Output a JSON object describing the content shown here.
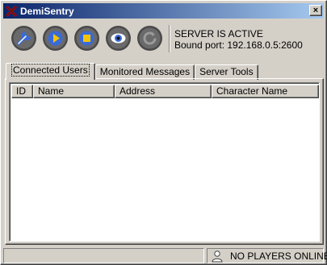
{
  "window": {
    "title": "DemiSentry",
    "close_glyph": "×"
  },
  "toolbar": {
    "buttons": [
      {
        "icon": "wrench-icon"
      },
      {
        "icon": "play-icon"
      },
      {
        "icon": "stop-icon"
      },
      {
        "icon": "eye-icon"
      },
      {
        "icon": "refresh-icon"
      }
    ]
  },
  "server": {
    "status": "SERVER IS ACTIVE",
    "port": "Bound port: 192.168.0.5:2600"
  },
  "tabs": [
    {
      "label": "Connected Users",
      "active": true
    },
    {
      "label": "Monitored Messages",
      "active": false
    },
    {
      "label": "Server Tools",
      "active": false
    }
  ],
  "list": {
    "columns": [
      "ID",
      "Name",
      "Address",
      "Character Name"
    ],
    "rows": []
  },
  "statusbar": {
    "players": "NO PLAYERS ONLINE"
  },
  "colors": {
    "title_start": "#0a246a",
    "title_end": "#a6caf0",
    "icon_blue": "#3a5aa8",
    "face": "#d4d0c8"
  }
}
